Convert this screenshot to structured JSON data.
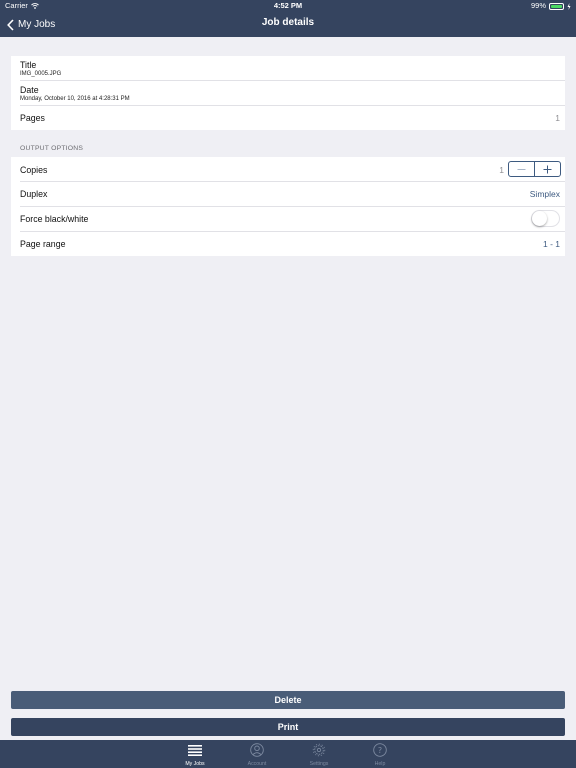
{
  "status_bar": {
    "carrier": "Carrier",
    "time": "4:52 PM",
    "battery": "99%",
    "battery_level": 0.99
  },
  "nav": {
    "back_label": "My Jobs",
    "title": "Job details"
  },
  "job_info": {
    "title_label": "Title",
    "title_value": "IMG_0005.JPG",
    "date_label": "Date",
    "date_value": "Monday, October 10, 2016 at 4:28:31 PM",
    "pages_label": "Pages",
    "pages_value": "1"
  },
  "output_options": {
    "header": "OUTPUT OPTIONS",
    "copies_label": "Copies",
    "copies_value": "1",
    "duplex_label": "Duplex",
    "duplex_value": "Simplex",
    "force_bw_label": "Force black/white",
    "force_bw_on": false,
    "page_range_label": "Page range",
    "page_range_value": "1 - 1"
  },
  "actions": {
    "delete_label": "Delete",
    "print_label": "Print"
  },
  "tabbar": {
    "items": [
      {
        "label": "My Jobs",
        "icon": "list-icon",
        "active": true
      },
      {
        "label": "Account",
        "icon": "account-icon",
        "active": false
      },
      {
        "label": "Settings",
        "icon": "gear-icon",
        "active": false
      },
      {
        "label": "Help",
        "icon": "help-icon",
        "active": false
      }
    ]
  },
  "colors": {
    "nav_bg": "#35445f",
    "accent": "#3d5a80",
    "background": "#efeff4",
    "battery_green": "#4cd964"
  }
}
